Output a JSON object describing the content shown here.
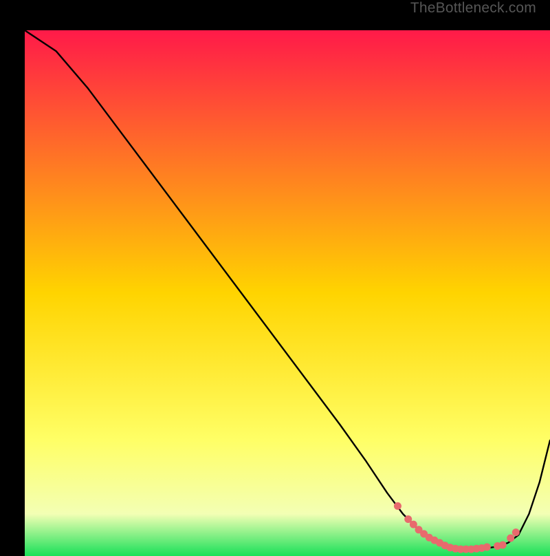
{
  "watermark": "TheBottleneck.com",
  "colors": {
    "grad_top": "#ff1a49",
    "grad_mid": "#ffd400",
    "grad_low": "#ffff66",
    "grad_bottom": "#18e058",
    "line": "#000000",
    "markers": "#e86a6d",
    "bg": "#000000"
  },
  "chart_data": {
    "type": "line",
    "title": "",
    "xlabel": "",
    "ylabel": "",
    "xlim": [
      0,
      100
    ],
    "ylim": [
      0,
      100
    ],
    "series": [
      {
        "name": "curve",
        "x": [
          0,
          6,
          12,
          18,
          24,
          30,
          36,
          42,
          48,
          54,
          60,
          65,
          69,
          72,
          75,
          78,
          80,
          82,
          84,
          86,
          88,
          90,
          92,
          94,
          96,
          98,
          100
        ],
        "y": [
          100,
          96,
          89,
          81,
          73,
          65,
          57,
          49,
          41,
          33,
          25,
          18,
          12,
          8,
          5,
          3,
          2,
          1.3,
          1.2,
          1.3,
          1.5,
          1.8,
          2.5,
          4,
          8,
          14,
          22
        ]
      }
    ],
    "markers": {
      "name": "cluster",
      "x": [
        71,
        73,
        74,
        75,
        76,
        77,
        78,
        79,
        80,
        81,
        82,
        83,
        84,
        85,
        86,
        87,
        88,
        90,
        91,
        92.5,
        93.5
      ],
      "y": [
        9.5,
        7,
        6,
        5,
        4.2,
        3.5,
        3,
        2.5,
        2,
        1.6,
        1.4,
        1.3,
        1.3,
        1.3,
        1.4,
        1.5,
        1.7,
        1.9,
        2.1,
        3.4,
        4.5
      ]
    }
  }
}
